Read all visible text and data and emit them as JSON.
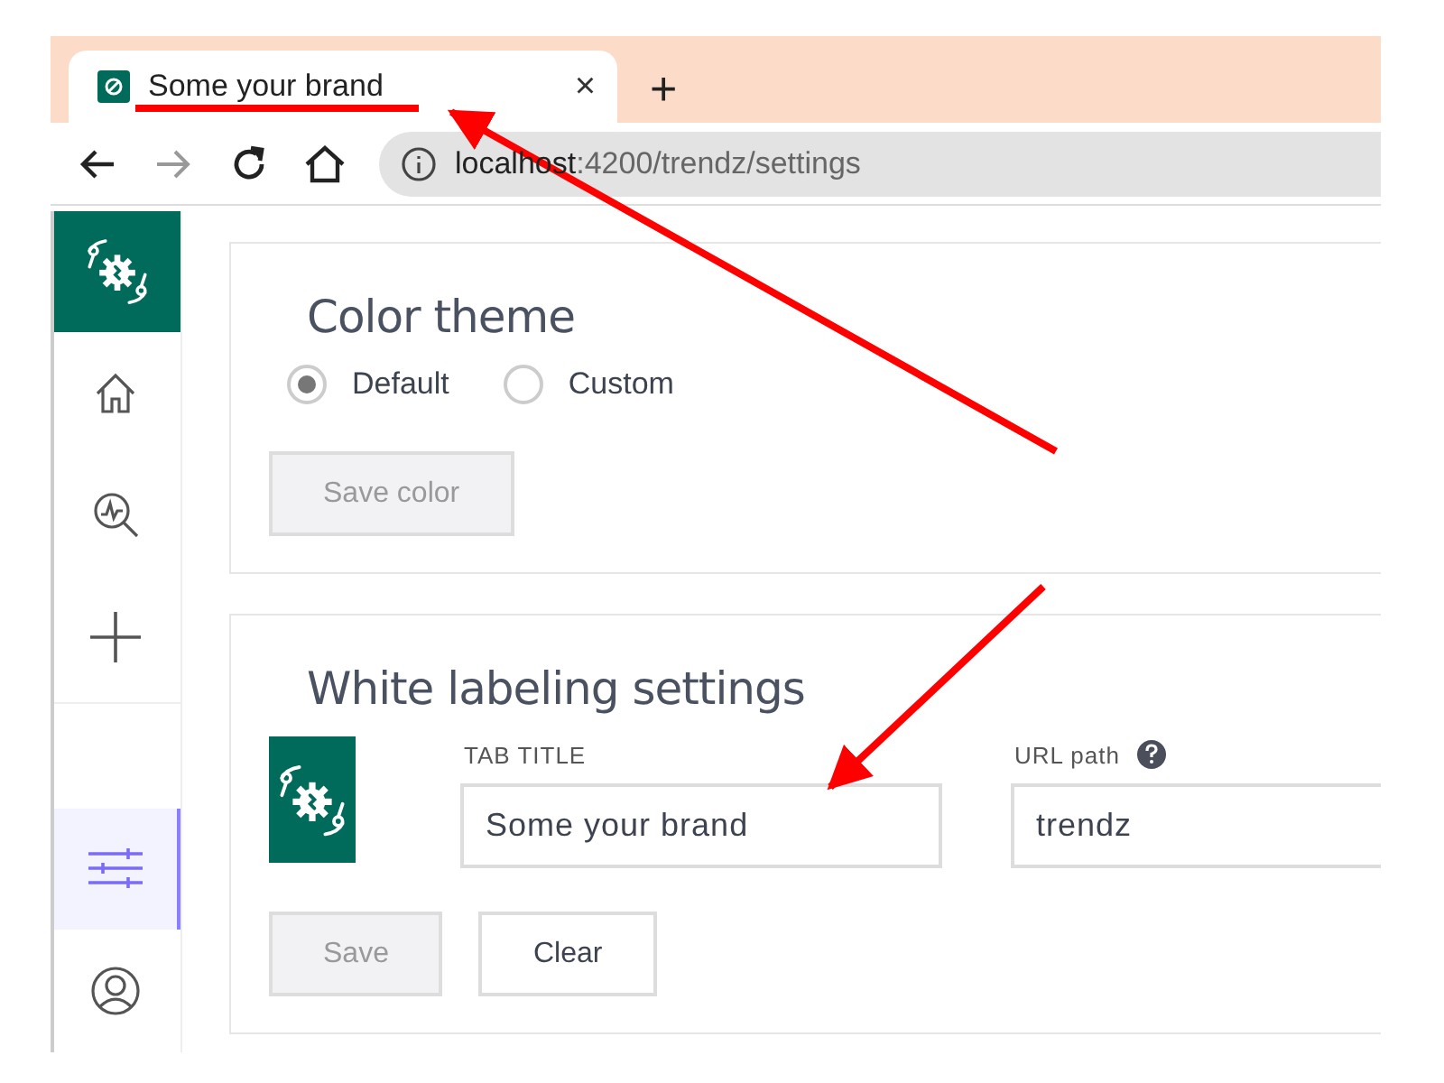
{
  "browser": {
    "tab": {
      "title": "Some your brand",
      "close": "×"
    },
    "new_tab": "+",
    "address": {
      "host": "localhost",
      "path": ":4200/trendz/settings"
    }
  },
  "sidebar": {
    "top_items": [
      {
        "kind": "home",
        "selected": false
      },
      {
        "kind": "search",
        "selected": false
      },
      {
        "kind": "add",
        "selected": false
      }
    ],
    "bottom_items": [
      {
        "kind": "settings",
        "selected": true
      },
      {
        "kind": "user",
        "selected": false
      }
    ]
  },
  "color_theme": {
    "title": "Color theme",
    "options": [
      {
        "label": "Default",
        "selected": true
      },
      {
        "label": "Custom",
        "selected": false
      }
    ],
    "save_button": {
      "label": "Save color",
      "disabled": true
    }
  },
  "white_labeling": {
    "title": "White labeling settings",
    "tab_title": {
      "label": "TAB TITLE",
      "value": "Some your brand"
    },
    "url_path": {
      "label": "URL path",
      "value": "trendz"
    },
    "buttons": [
      {
        "label": "Save",
        "disabled": true
      },
      {
        "label": "Clear",
        "disabled": false
      }
    ]
  }
}
